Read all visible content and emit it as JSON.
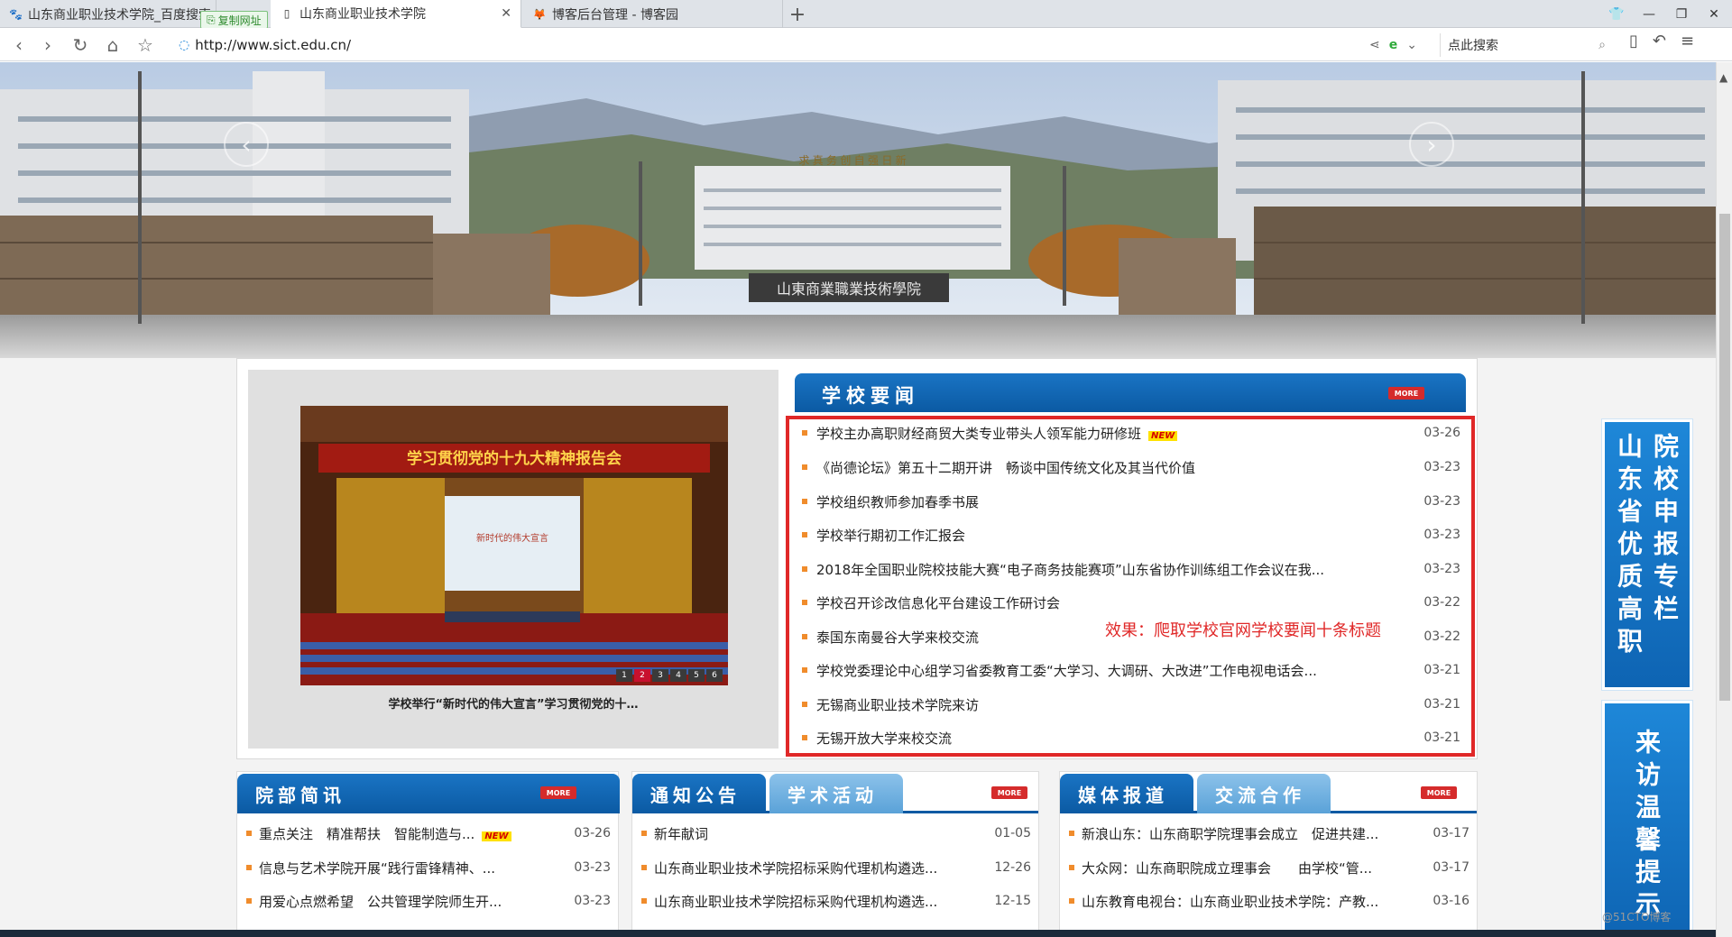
{
  "browser": {
    "tabs": [
      {
        "label": "山东商业职业技术学院_百度搜索",
        "icon": "paw-icon"
      },
      {
        "label": "山东商业职业技术学院",
        "icon": "page-icon"
      },
      {
        "label": "博客后台管理 - 博客园",
        "icon": "blog-icon"
      }
    ],
    "copy_badge": "复制网址",
    "new_tab": "+",
    "url": "http://www.sict.edu.cn/",
    "search_placeholder": "点此搜索"
  },
  "banner": {
    "gate_sign": "山東商業職業技術學院",
    "building_slogan": "求 真 务 创 自 强 日 新"
  },
  "featured_photo": {
    "stage_banner": "学习贯彻党的十九大精神报告会",
    "screen_text": "新时代的伟大宣言",
    "caption": "学校举行“新时代的伟大宣言”学习贯彻党的十…",
    "dots": [
      "1",
      "2",
      "3",
      "4",
      "5",
      "6"
    ],
    "active_dot": 1
  },
  "school_news": {
    "title": "学校要闻",
    "more": "MORE",
    "items": [
      {
        "title": "学校主办高职财经商贸大类专业带头人领军能力研修班",
        "date": "03-26",
        "is_new": true
      },
      {
        "title": "《尚德论坛》第五十二期开讲　畅谈中国传统文化及其当代价值",
        "date": "03-23"
      },
      {
        "title": "学校组织教师参加春季书展",
        "date": "03-23"
      },
      {
        "title": "学校举行期初工作汇报会",
        "date": "03-23"
      },
      {
        "title": "2018年全国职业院校技能大赛“电子商务技能赛项”山东省协作训练组工作会议在我...",
        "date": "03-23"
      },
      {
        "title": "学校召开诊改信息化平台建设工作研讨会",
        "date": "03-22"
      },
      {
        "title": "泰国东南曼谷大学来校交流",
        "date": "03-22"
      },
      {
        "title": "学校党委理论中心组学习省委教育工委“大学习、大调研、大改进”工作电视电话会...",
        "date": "03-21"
      },
      {
        "title": "无锡商业职业技术学院来访",
        "date": "03-21"
      },
      {
        "title": "无锡开放大学来校交流",
        "date": "03-21"
      }
    ],
    "new_badge": "NEW",
    "annotation": "效果：爬取学校官网学校要闻十条标题"
  },
  "columns": [
    {
      "tabs": [
        "院部简讯"
      ],
      "more": "MORE",
      "items": [
        {
          "title": "重点关注　精准帮扶　智能制造与...",
          "date": "03-26",
          "is_new": true
        },
        {
          "title": "信息与艺术学院开展“践行雷锋精神、...",
          "date": "03-23"
        },
        {
          "title": "用爱心点燃希望　公共管理学院师生开...",
          "date": "03-23"
        }
      ]
    },
    {
      "tabs": [
        "通知公告",
        "学术活动"
      ],
      "more": "MORE",
      "items": [
        {
          "title": "新年献词",
          "date": "01-05"
        },
        {
          "title": "山东商业职业技术学院招标采购代理机构遴选...",
          "date": "12-26"
        },
        {
          "title": "山东商业职业技术学院招标采购代理机构遴选...",
          "date": "12-15"
        }
      ]
    },
    {
      "tabs": [
        "媒体报道",
        "交流合作"
      ],
      "more": "MORE",
      "items": [
        {
          "title": "新浪山东：山东商职学院理事会成立　促进共建...",
          "date": "03-17"
        },
        {
          "title": "大众网：山东商职院成立理事会　　由学校“管...",
          "date": "03-17"
        },
        {
          "title": "山东教育电视台：山东商业职业技术学院：产教...",
          "date": "03-16"
        }
      ]
    }
  ],
  "side_banners": [
    {
      "col1": "山东省优质高职",
      "col2": "院校申报专栏"
    },
    {
      "col1": "来访温馨提示"
    }
  ],
  "watermark": "@51CTO博客",
  "colors": {
    "brand_blue": "#0b5aa3",
    "highlight_red": "#e02828",
    "bullet_orange": "#f08c2c"
  }
}
